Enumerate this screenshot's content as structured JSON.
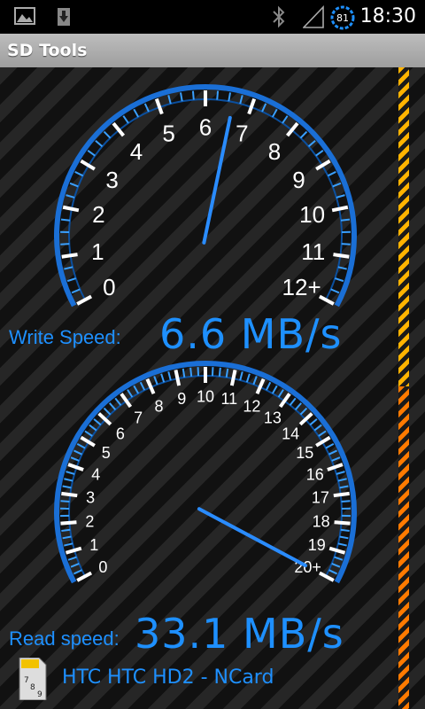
{
  "status_bar": {
    "time": "18:30",
    "battery_level": "81",
    "icons": [
      "image-icon",
      "download-icon",
      "bluetooth-icon",
      "signal-icon",
      "battery-icon"
    ]
  },
  "app": {
    "title": "SD Tools"
  },
  "write_gauge": {
    "label": "Write Speed:",
    "value_text": "6.6 MB/s",
    "value": 6.6,
    "max": 12,
    "tick_labels": [
      "0",
      "1",
      "2",
      "3",
      "4",
      "5",
      "6",
      "7",
      "8",
      "9",
      "10",
      "11",
      "12+"
    ]
  },
  "read_gauge": {
    "label": "Read speed:",
    "value_text": "33.1 MB/s",
    "value": 33.1,
    "max": 20,
    "tick_labels": [
      "0",
      "1",
      "2",
      "3",
      "4",
      "5",
      "6",
      "7",
      "8",
      "9",
      "10",
      "11",
      "12",
      "13",
      "14",
      "15",
      "16",
      "17",
      "18",
      "19",
      "20+"
    ]
  },
  "device": {
    "name": "HTC HTC HD2 - NCard",
    "card_icon_digits": [
      "7",
      "8",
      "9"
    ]
  },
  "colors": {
    "accent": "#1e90ff",
    "gauge_rim": "#1a6fd6",
    "stripe_top": "#ffb300",
    "stripe_bottom": "#ff7a00"
  }
}
